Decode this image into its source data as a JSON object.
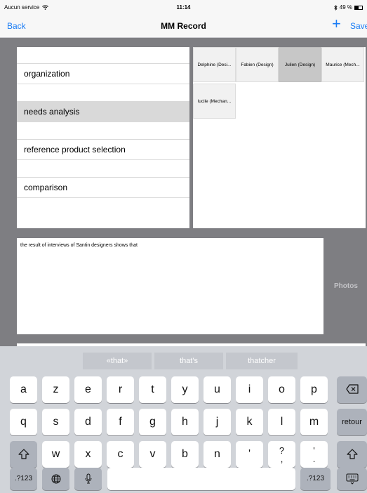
{
  "status_bar": {
    "carrier": "Aucun service",
    "time": "11:14",
    "battery": "49 %"
  },
  "nav": {
    "back": "Back",
    "title": "MM Record",
    "add": "+",
    "save": "Save"
  },
  "phases": [
    {
      "label": "organization"
    },
    {
      "label": "needs analysis",
      "selected": true
    },
    {
      "label": "reference product selection"
    },
    {
      "label": "comparison"
    }
  ],
  "participants": [
    {
      "label": "Delphine  (Desi..."
    },
    {
      "label": "Fabien (Design)"
    },
    {
      "label": "Julien (Design)",
      "selected": true
    },
    {
      "label": "Maurice (Mech..."
    },
    {
      "label": "lucile  (Mechan..."
    }
  ],
  "note": {
    "text": "the result of interviews of Santin designers shows that"
  },
  "photos_label": "Photos",
  "keyboard": {
    "suggestions": [
      "«that»",
      "that's",
      "thatcher"
    ],
    "row1": [
      "a",
      "z",
      "e",
      "r",
      "t",
      "y",
      "u",
      "i",
      "o",
      "p"
    ],
    "row2": [
      "q",
      "s",
      "d",
      "f",
      "g",
      "h",
      "j",
      "k",
      "l",
      "m"
    ],
    "row3": [
      "w",
      "x",
      "c",
      "v",
      "b",
      "n",
      "'"
    ],
    "question_key": {
      "top": "?",
      "bottom": ","
    },
    "period_key": {
      "top": "'",
      "bottom": "."
    },
    "return": "retour",
    "numbers": ".?123"
  },
  "icons": {
    "wifi": "wifi-icon",
    "bluetooth": "bluetooth-icon",
    "battery": "battery-icon",
    "delete": "backspace-icon",
    "shift": "shift-icon",
    "globe": "globe-icon",
    "mic": "microphone-icon",
    "hide_keyboard": "hide-keyboard-icon"
  },
  "colors": {
    "accent": "#1a7cf5",
    "background": "#7e7e82",
    "keyboard": "#d1d4d9",
    "selected_row": "#d9d9d9"
  }
}
